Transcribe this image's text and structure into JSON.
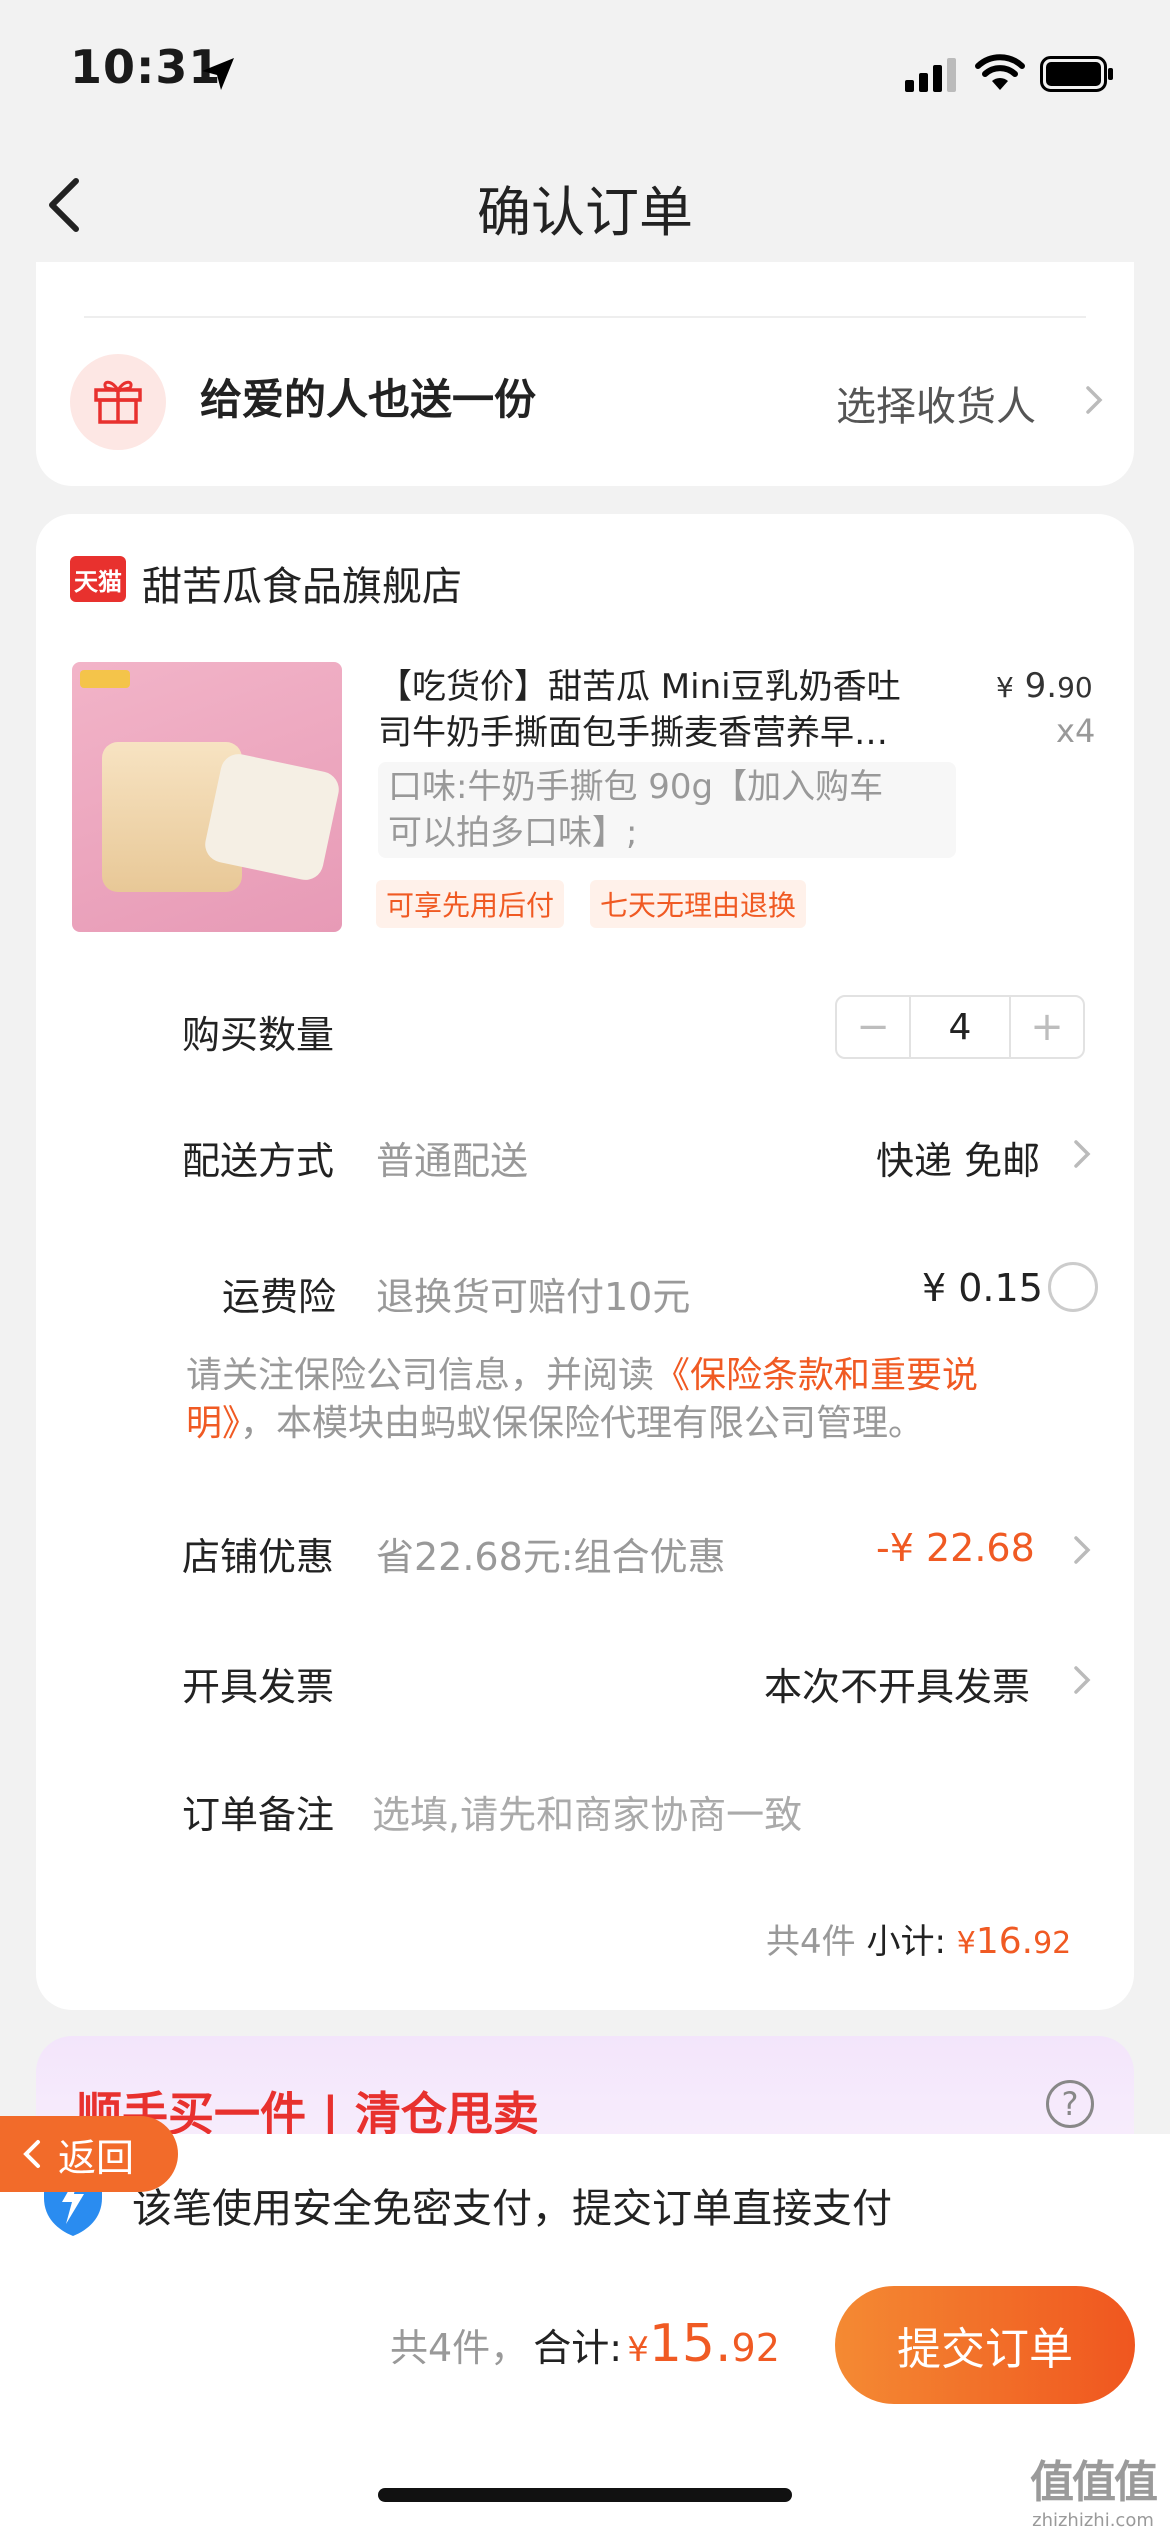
{
  "status": {
    "time": "10:31"
  },
  "nav": {
    "title": "确认订单"
  },
  "gift": {
    "title": "给爱的人也送一份",
    "action": "选择收货人"
  },
  "shop": {
    "badge": "天猫",
    "name": "甜苦瓜食品旗舰店",
    "product": {
      "title_line1": "【吃货价】甜苦瓜 Mini豆乳奶香吐",
      "title_line2": "司牛奶手撕面包手撕麦香营养早…",
      "price_symbol": "¥",
      "price_int": "9.",
      "price_dec": "90",
      "qty": "x4",
      "spec_line1": "口味:牛奶手撕包 90g【加入购车",
      "spec_line2": "可以拍多口味】;",
      "tags": [
        "可享先用后付",
        "七天无理由退换"
      ]
    },
    "quantity": {
      "label": "购买数量",
      "value": "4",
      "minus": "−",
      "plus": "+"
    },
    "delivery": {
      "label": "配送方式",
      "value": "普通配送",
      "right": "快递 免邮"
    },
    "insurance": {
      "label": "运费险",
      "value": "退换货可赔付10元",
      "price": "¥ 0.15",
      "note_prefix": "请关注保险公司信息，并阅读",
      "note_link_1": "《保险条款和重要说",
      "note_link_2": "明》",
      "note_suffix": "，本模块由蚂蚁保保险代理有限公司管理。"
    },
    "discount": {
      "label": "店铺优惠",
      "value": "省22.68元:组合优惠",
      "amount": "-¥ 22.68"
    },
    "invoice": {
      "label": "开具发票",
      "value": "本次不开具发票"
    },
    "remark": {
      "label": "订单备注",
      "placeholder": "选填,请先和商家协商一致"
    },
    "subtotal": {
      "count": "共4件",
      "label": "小计:",
      "symbol": "¥",
      "int": "16.",
      "dec": "92"
    }
  },
  "promo": {
    "title": "顺手买一件 | 清仓甩卖"
  },
  "back_float": {
    "label": "返回"
  },
  "pay_notice": "该笔使用安全免密支付，提交订单直接支付",
  "footer": {
    "count": "共4件，",
    "total_label": "合计:",
    "symbol": "¥",
    "int": "15.",
    "dec": "92",
    "submit": "提交订单"
  },
  "watermark": {
    "text": "值值值",
    "url": "zhizhizhi.com"
  },
  "colors": {
    "accent": "#f05a23",
    "tmall": "#e8312e"
  }
}
